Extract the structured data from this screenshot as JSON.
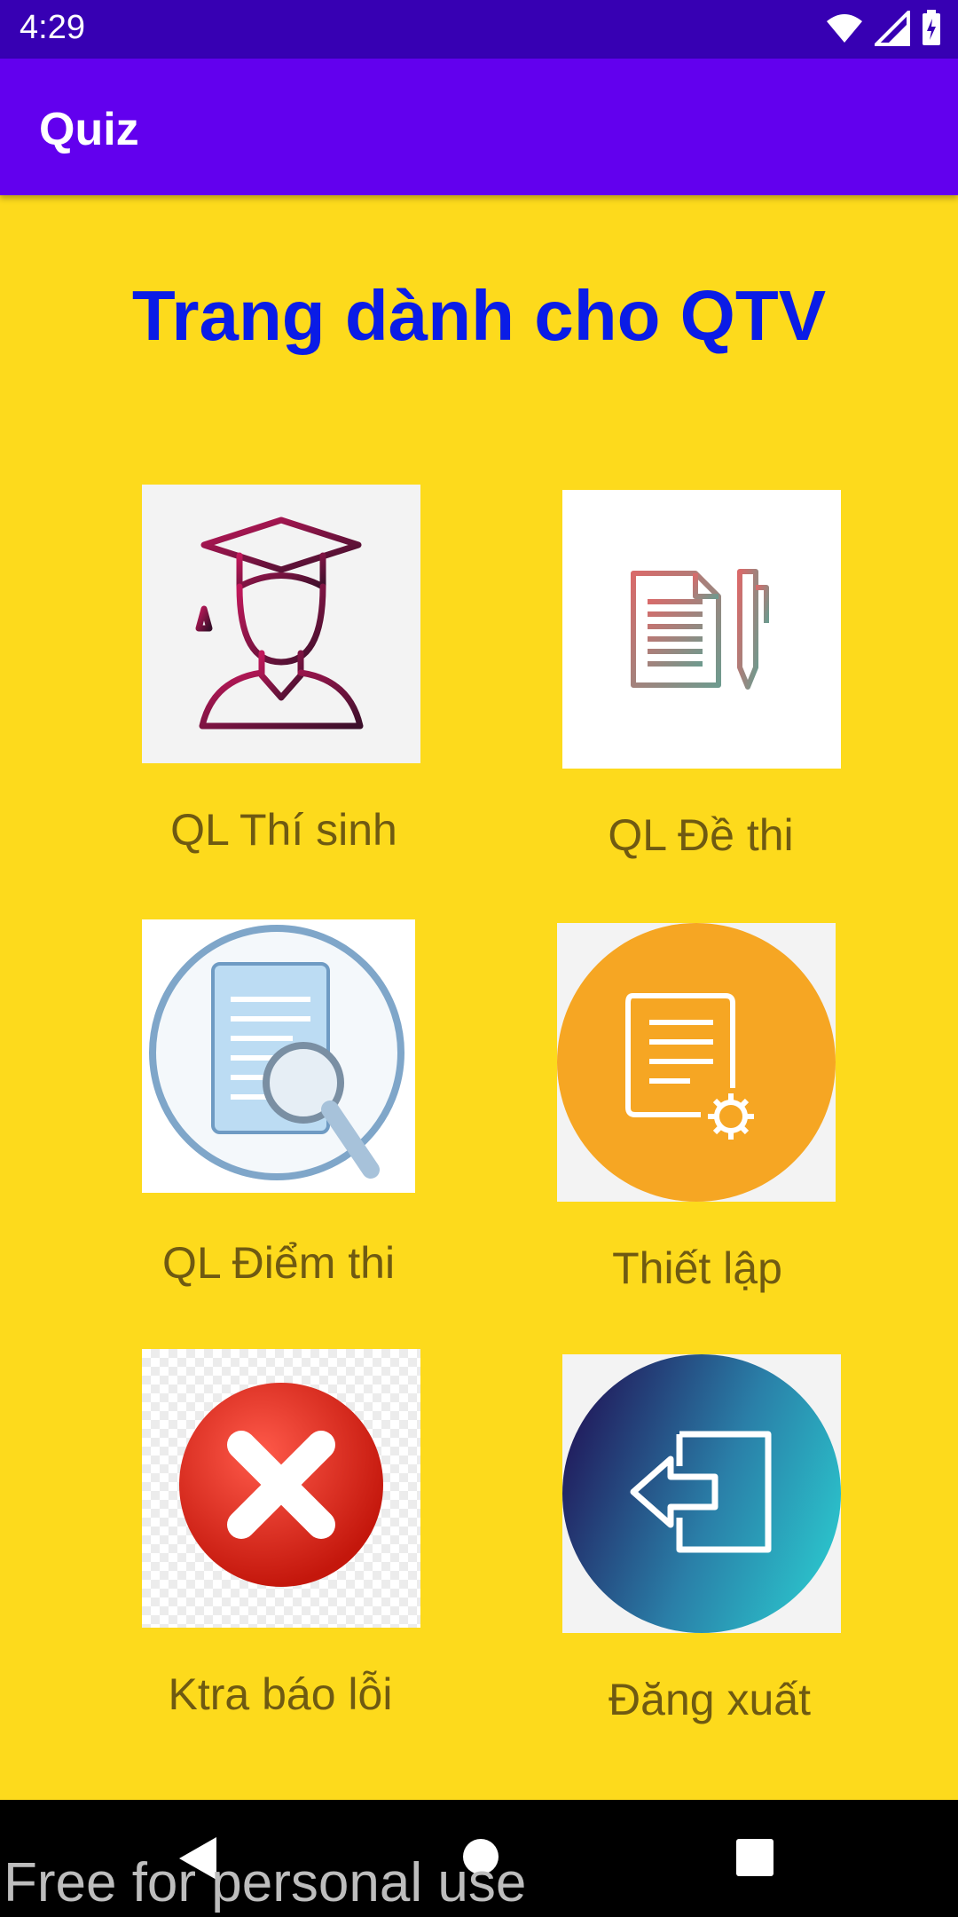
{
  "status_bar": {
    "time": "4:29",
    "icons": [
      "wifi-icon",
      "cellular-signal-icon",
      "battery-icon"
    ]
  },
  "app_bar": {
    "title": "Quiz"
  },
  "page": {
    "heading": "Trang dành cho QTV"
  },
  "menu": {
    "items": [
      {
        "label": "QL Thí sinh",
        "icon": "student-graduate-icon"
      },
      {
        "label": "QL Đề thi",
        "icon": "document-pen-icon"
      },
      {
        "label": "QL Điểm thi",
        "icon": "document-search-icon"
      },
      {
        "label": "Thiết lập",
        "icon": "document-settings-icon"
      },
      {
        "label": "Ktra báo lỗi",
        "icon": "error-x-icon"
      },
      {
        "label": "Đăng xuất",
        "icon": "logout-icon"
      }
    ]
  },
  "nav_bar": {
    "buttons": [
      "back-icon",
      "home-icon",
      "recents-icon"
    ]
  },
  "watermark": "Free for personal use",
  "colors": {
    "status_bar": "#3700B3",
    "app_bar": "#6200EE",
    "background": "#FDDA1C",
    "heading": "#0A1CE6",
    "label": "#6F5A12"
  }
}
